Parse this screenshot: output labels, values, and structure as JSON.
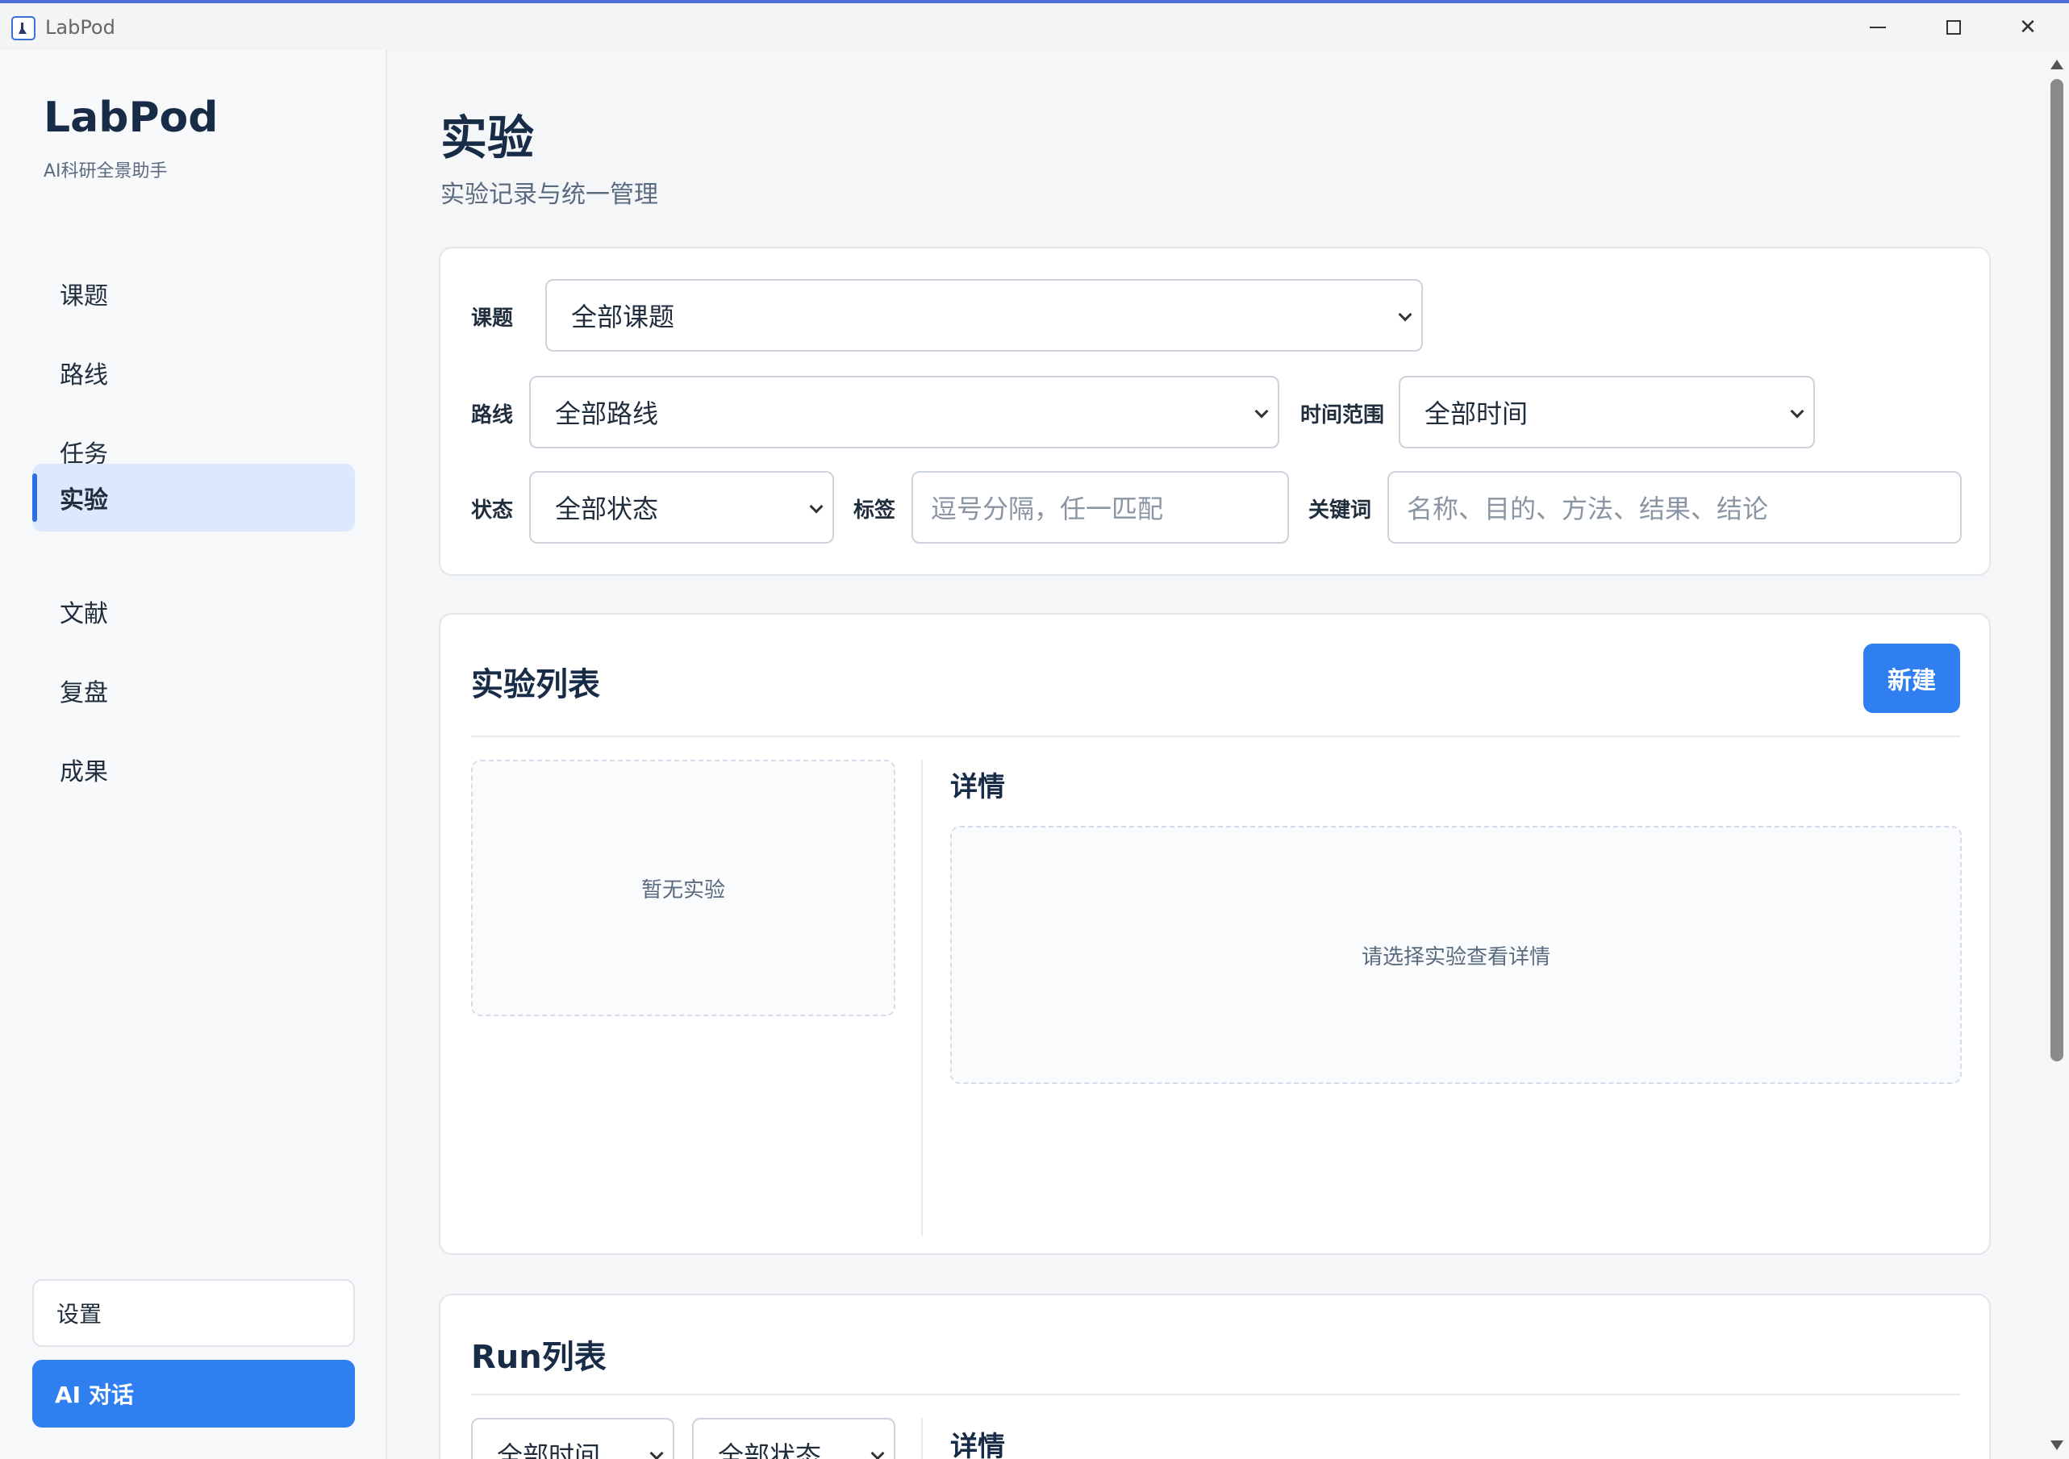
{
  "window": {
    "title": "LabPod"
  },
  "sidebar": {
    "brand": "LabPod",
    "subtitle": "AI科研全景助手",
    "items": [
      {
        "label": "课题"
      },
      {
        "label": "路线"
      },
      {
        "label": "任务"
      },
      {
        "label": "实验",
        "active": true
      },
      {
        "label": "文献"
      },
      {
        "label": "复盘"
      },
      {
        "label": "成果"
      }
    ],
    "settings_label": "设置",
    "ai_label": "AI 对话"
  },
  "header": {
    "title": "实验",
    "subtitle": "实验记录与统一管理"
  },
  "filters": {
    "topic_label": "课题",
    "topic_value": "全部课题",
    "route_label": "路线",
    "route_value": "全部路线",
    "time_label": "时间范围",
    "time_value": "全部时间",
    "status_label": "状态",
    "status_value": "全部状态",
    "tag_label": "标签",
    "tag_placeholder": "逗号分隔，任一匹配",
    "keyword_label": "关键词",
    "keyword_placeholder": "名称、目的、方法、结果、结论"
  },
  "experiment_list": {
    "title": "实验列表",
    "new_label": "新建",
    "empty_text": "暂无实验",
    "detail_title": "详情",
    "detail_empty": "请选择实验查看详情"
  },
  "run_list": {
    "title": "Run列表",
    "time_value": "全部时间",
    "status_value": "全部状态",
    "detail_title": "详情"
  },
  "colors": {
    "accent": "#2f7ff0",
    "active_bg": "#dce9fd",
    "background": "#f5f6f8"
  }
}
